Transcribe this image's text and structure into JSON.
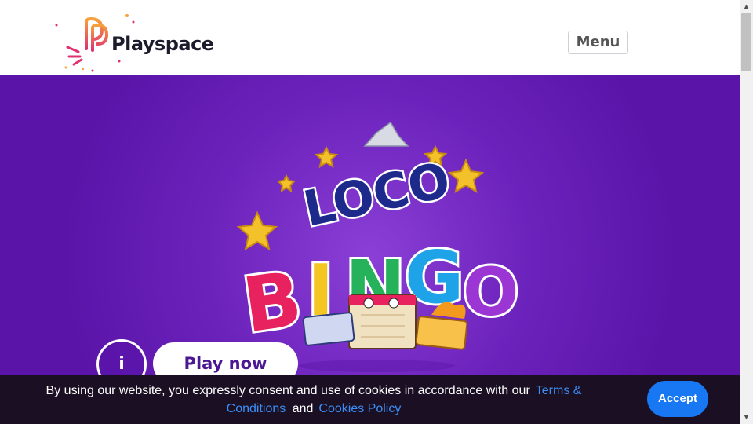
{
  "header": {
    "logo_text": "Playspace",
    "menu_label": "Menu"
  },
  "hero": {
    "game_title_line1": "LOCO",
    "game_title_line2": "BINGO",
    "info_label": "i",
    "play_label": "Play now"
  },
  "cookie_banner": {
    "text": "By using our website, you expressly consent and use of cookies in accordance with our",
    "terms_link": "Terms & Conditions",
    "and_text": "and",
    "cookies_link": "Cookies Policy",
    "accept_label": "Accept"
  },
  "colors": {
    "brand_purple": "#6b22bb",
    "accept_blue": "#1877f2",
    "link_blue": "#3b8ef6",
    "banner_dark": "#1b0f23"
  }
}
